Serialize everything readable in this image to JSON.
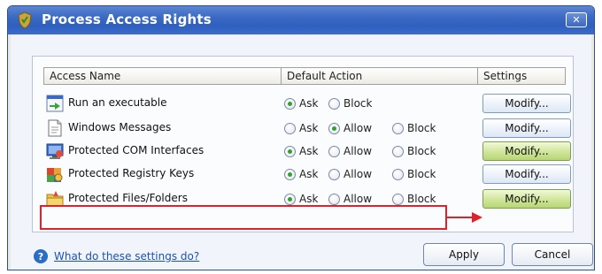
{
  "window": {
    "title": "Process Access Rights",
    "close_label": "✕"
  },
  "table": {
    "headers": {
      "name": "Access Name",
      "action": "Default Action",
      "settings": "Settings"
    }
  },
  "rows": [
    {
      "label": "Run an executable",
      "icon": "executable-icon",
      "options": [
        "Ask",
        "Block"
      ],
      "selected": "Ask",
      "button": "Modify..."
    },
    {
      "label": "Windows Messages",
      "icon": "document-icon",
      "options": [
        "Ask",
        "Allow",
        "Block"
      ],
      "selected": "Allow",
      "button": "Modify..."
    },
    {
      "label": "Protected COM Interfaces",
      "icon": "com-interfaces-icon",
      "options": [
        "Ask",
        "Allow",
        "Block"
      ],
      "selected": "Ask",
      "button": "Modify..."
    },
    {
      "label": "Protected Registry Keys",
      "icon": "registry-keys-icon",
      "options": [
        "Ask",
        "Allow",
        "Block"
      ],
      "selected": "Ask",
      "button": "Modify..."
    },
    {
      "label": "Protected Files/Folders",
      "icon": "folder-icon",
      "options": [
        "Ask",
        "Allow",
        "Block"
      ],
      "selected": "Ask",
      "button": "Modify..."
    }
  ],
  "footer": {
    "help_text": "What do these settings do?",
    "apply_label": "Apply",
    "cancel_label": "Cancel"
  },
  "colors": {
    "highlight": "#e0202a",
    "accent": "#2f5fbf",
    "selected_radio": "#2fa12f"
  }
}
